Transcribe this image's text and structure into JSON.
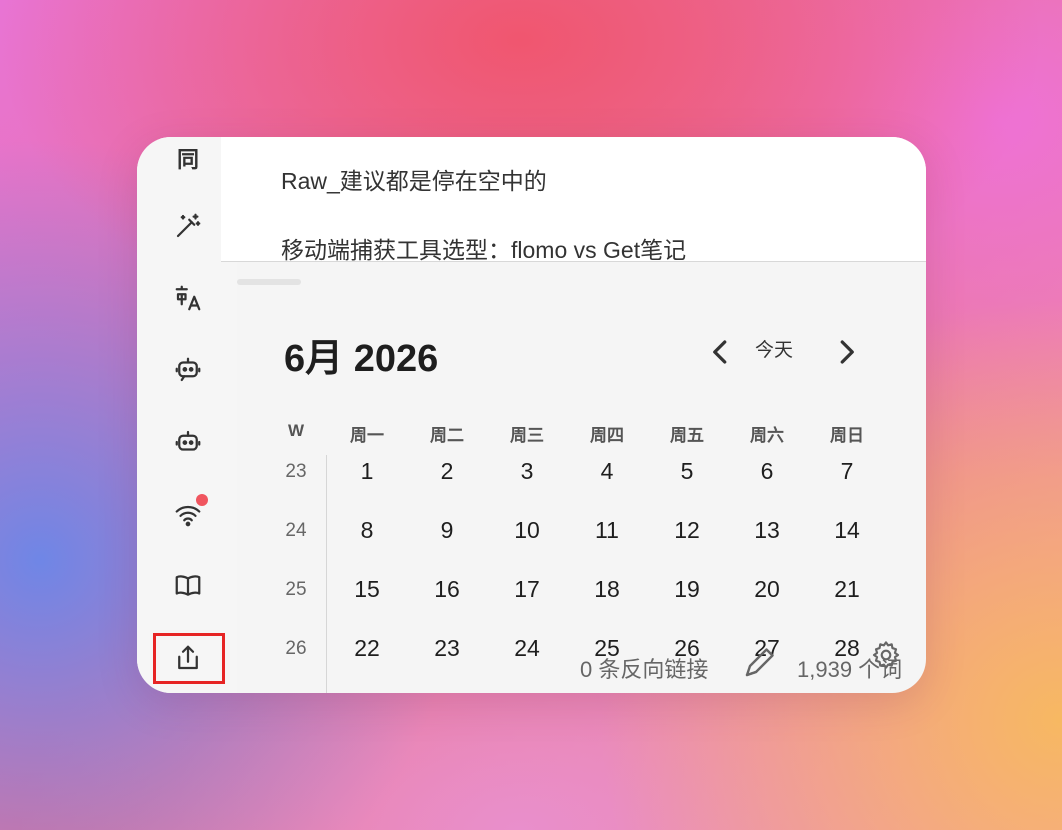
{
  "notes": {
    "items": [
      {
        "title": "Raw_建议都是停在空中的"
      },
      {
        "title": "移动端捕获工具选型：flomo vs Get笔记"
      }
    ]
  },
  "sidebar": {
    "sync_label": "同",
    "icons": [
      "magic-wand-icon",
      "translate-icon",
      "robot-icon",
      "robot-alt-icon",
      "wifi-icon",
      "book-icon",
      "share-icon"
    ]
  },
  "calendar": {
    "month_label": "6月 2026",
    "today_label": "今天",
    "week_header": "W",
    "weekdays": [
      "周一",
      "周二",
      "周三",
      "周四",
      "周五",
      "周六",
      "周日"
    ],
    "weeks": [
      {
        "num": "23",
        "days": [
          "1",
          "2",
          "3",
          "4",
          "5",
          "6",
          "7"
        ]
      },
      {
        "num": "24",
        "days": [
          "8",
          "9",
          "10",
          "11",
          "12",
          "13",
          "14"
        ]
      },
      {
        "num": "25",
        "days": [
          "15",
          "16",
          "17",
          "18",
          "19",
          "20",
          "21"
        ]
      },
      {
        "num": "26",
        "days": [
          "22",
          "23",
          "24",
          "25",
          "26",
          "27",
          "28"
        ]
      }
    ]
  },
  "status": {
    "backlinks": "0 条反向链接",
    "words": "1,939 个词"
  },
  "colors": {
    "accent_highlight": "#e62424",
    "notification_dot": "#f0555f"
  }
}
